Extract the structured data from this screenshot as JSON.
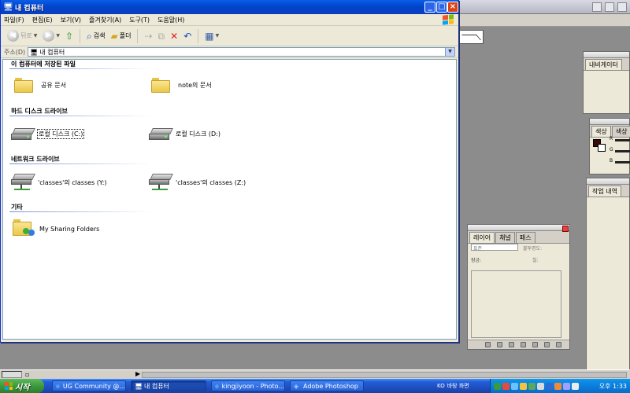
{
  "window": {
    "title": "내 컴퓨터",
    "menu": [
      "파일(F)",
      "편집(E)",
      "보기(V)",
      "즐겨찾기(A)",
      "도구(T)",
      "도움말(H)"
    ],
    "toolbar": {
      "back_label": "뒤로",
      "search_label": "검색",
      "folders_label": "폴더"
    },
    "address": {
      "label": "주소(D)",
      "value": "내 컴퓨터"
    }
  },
  "groups": [
    {
      "header": "이 컴퓨터에 저장된 파일",
      "items": [
        {
          "label": "공유 문서",
          "icon": "folder-icon"
        },
        {
          "label": "note의 문서",
          "icon": "folder-icon"
        }
      ]
    },
    {
      "header": "하드 디스크 드라이브",
      "items": [
        {
          "label": "로컬 디스크 (C:)",
          "icon": "hard-drive-icon"
        },
        {
          "label": "로컬 디스크 (D:)",
          "icon": "hard-drive-icon"
        }
      ]
    },
    {
      "header": "네트워크 드라이브",
      "items": [
        {
          "label": "'classes'의 classes (Y:)",
          "icon": "network-drive-icon"
        },
        {
          "label": "'classes'의 classes (Z:)",
          "icon": "network-drive-icon"
        }
      ]
    },
    {
      "header": "기타",
      "items": [
        {
          "label": "My Sharing Folders",
          "icon": "sharing-folder-icon"
        }
      ]
    }
  ],
  "photoshop": {
    "navigator_tab": "내비게이터",
    "color_tabs": [
      "색상",
      "색상"
    ],
    "color_channels": [
      "R",
      "G",
      "B"
    ],
    "history_tab": "작업 내역",
    "layer_tabs": [
      "레이어",
      "채널",
      "패스"
    ],
    "layer_blend": "표준",
    "layer_opacity_label": "불투명도:",
    "layer_lock_label": "잠금:",
    "layer_fill_label": "칠:"
  },
  "taskbar": {
    "start_label": "시작",
    "tasks": [
      {
        "label": "UG Community @...",
        "icon": "ie-icon"
      },
      {
        "label": "내 컴퓨터",
        "icon": "my-computer-icon",
        "active": true
      },
      {
        "label": "kingjiyoon - Photo...",
        "icon": "ie-icon"
      },
      {
        "label": "Adobe Photoshop",
        "icon": "photoshop-icon"
      }
    ],
    "language": "KO",
    "desktop_label": "바탕 화면",
    "clock": "오후 1:33"
  },
  "colors": {
    "titlebar": "#0054e3",
    "close_button": "#d9431c",
    "taskbar": "#245edb",
    "start_button": "#3c9a3c",
    "folder": "#f2d36b"
  }
}
